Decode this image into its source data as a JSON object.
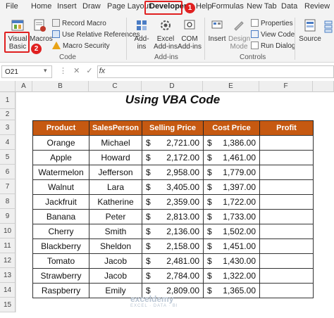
{
  "menu_tabs": [
    "File",
    "Home",
    "Insert",
    "Draw",
    "Page Layout",
    "Developer",
    "Help",
    "Formulas",
    "New Tab",
    "Data",
    "Review"
  ],
  "active_tab": "Developer",
  "step_badges": [
    "1",
    "2"
  ],
  "ribbon": {
    "code_group": {
      "visual_basic_line1": "Visual",
      "visual_basic_line2": "Basic",
      "macros": "Macros",
      "record_macro": "Record Macro",
      "relative_refs": "Use Relative References",
      "macro_security": "Macro Security",
      "label": "Code"
    },
    "addins_group": {
      "addins_line1": "Add-",
      "addins_line2": "ins",
      "excel_addins_line1": "Excel",
      "excel_addins_line2": "Add-ins",
      "com_addins_line1": "COM",
      "com_addins_line2": "Add-ins",
      "label": "Add-ins"
    },
    "controls_group": {
      "insert": "Insert",
      "design_mode_line1": "Design",
      "design_mode_line2": "Mode",
      "properties": "Properties",
      "view_code": "View Code",
      "run_dialog": "Run Dialog",
      "label": "Controls"
    },
    "xml_group": {
      "source": "Source"
    }
  },
  "formula_bar": {
    "name_box": "O21",
    "fx": "fx",
    "content": ""
  },
  "columns": [
    "A",
    "B",
    "C",
    "D",
    "E",
    "F"
  ],
  "rows": [
    "1",
    "2",
    "3",
    "4",
    "5",
    "6",
    "7",
    "8",
    "9",
    "10",
    "11",
    "12",
    "13",
    "14",
    "15"
  ],
  "sheet": {
    "title": "Using VBA Code",
    "headers": [
      "Product",
      "SalesPerson",
      "Selling Price",
      "Cost Price",
      "Profit"
    ],
    "currency_symbol": "$",
    "records": [
      {
        "product": "Orange",
        "salesperson": "Michael",
        "selling": "2,721.00",
        "cost": "1,386.00"
      },
      {
        "product": "Apple",
        "salesperson": "Howard",
        "selling": "2,172.00",
        "cost": "1,461.00"
      },
      {
        "product": "Watermelon",
        "salesperson": "Jefferson",
        "selling": "2,958.00",
        "cost": "1,779.00"
      },
      {
        "product": "Walnut",
        "salesperson": "Lara",
        "selling": "3,405.00",
        "cost": "1,397.00"
      },
      {
        "product": "Jackfruit",
        "salesperson": "Katherine",
        "selling": "2,359.00",
        "cost": "1,722.00"
      },
      {
        "product": "Banana",
        "salesperson": "Peter",
        "selling": "2,813.00",
        "cost": "1,733.00"
      },
      {
        "product": "Cherry",
        "salesperson": "Smith",
        "selling": "2,136.00",
        "cost": "1,502.00"
      },
      {
        "product": "Blackberry",
        "salesperson": "Sheldon",
        "selling": "2,158.00",
        "cost": "1,451.00"
      },
      {
        "product": "Tomato",
        "salesperson": "Jacob",
        "selling": "2,481.00",
        "cost": "1,430.00"
      },
      {
        "product": "Strawberry",
        "salesperson": "Jacob",
        "selling": "2,784.00",
        "cost": "1,322.00"
      },
      {
        "product": "Raspberry",
        "salesperson": "Emily",
        "selling": "2,809.00",
        "cost": "1,365.00"
      }
    ]
  },
  "watermark": {
    "brand": "exceldemy",
    "tagline": "EXCEL · DATA · BI"
  },
  "colors": {
    "header_fill": "#c65911",
    "highlight": "#e02020"
  }
}
